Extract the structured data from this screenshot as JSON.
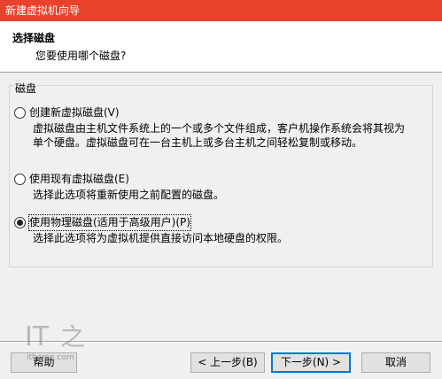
{
  "window": {
    "title": "新建虚拟机向导"
  },
  "header": {
    "title": "选择磁盘",
    "subtitle": "您要使用哪个磁盘?"
  },
  "group": {
    "legend": "磁盘",
    "options": [
      {
        "label": "创建新虚拟磁盘(V)",
        "description": "虚拟磁盘由主机文件系统上的一个或多个文件组成，客户机操作系统会将其视为单个硬盘。虚拟磁盘可在一台主机上或多台主机之间轻松复制或移动。",
        "checked": false
      },
      {
        "label": "使用现有虚拟磁盘(E)",
        "description": "选择此选项将重新使用之前配置的磁盘。",
        "checked": false
      },
      {
        "label": "使用物理磁盘(适用于高级用户)(P)",
        "description": "选择此选项将为虚拟机提供直接访问本地硬盘的权限。",
        "checked": true
      }
    ]
  },
  "buttons": {
    "help": "帮助",
    "back": "< 上一步(B)",
    "next": "下一步(N) >",
    "cancel": "取消"
  },
  "watermark": {
    "text": "ithome.com"
  },
  "colors": {
    "titlebar": "#e8412c",
    "focus": "#0078d7"
  }
}
